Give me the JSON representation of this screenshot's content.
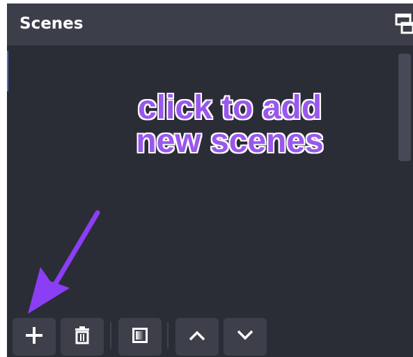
{
  "dock": {
    "title": "Scenes"
  },
  "annotation": {
    "line1": "click to add",
    "line2": "new scenes",
    "color": "#9a57ee"
  },
  "toolbar": {
    "buttons": [
      {
        "icon": "plus-icon"
      },
      {
        "icon": "trash-icon"
      },
      {
        "icon": "filter-icon"
      },
      {
        "icon": "chevron-up-icon"
      },
      {
        "icon": "chevron-down-icon"
      }
    ]
  },
  "colors": {
    "panel_bg": "#2b2d36",
    "title_bg": "#3c3f4a",
    "button_bg": "#3d404b",
    "accent": "#3f6ed8"
  }
}
